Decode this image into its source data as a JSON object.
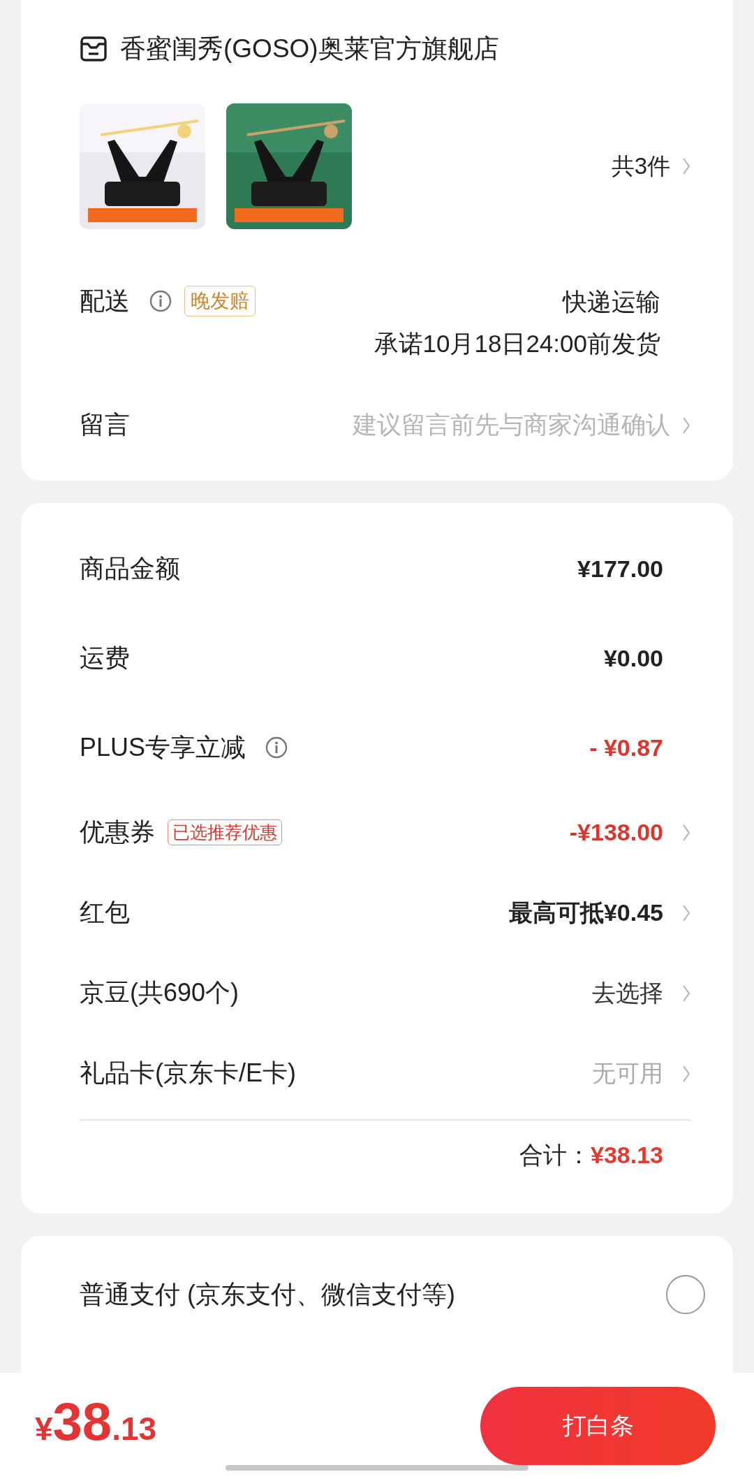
{
  "store": {
    "name": "香蜜闺秀(GOSO)奥莱官方旗舰店"
  },
  "item_count": "共3件",
  "delivery": {
    "label": "配送",
    "badge": "晚发赔",
    "method": "快递运输",
    "promise": "承诺10月18日24:00前发货"
  },
  "message": {
    "label": "留言",
    "hint": "建议留言前先与商家沟通确认"
  },
  "summary": [
    {
      "label": "商品金额",
      "info": false,
      "value": "¥177.00",
      "kind": "plain",
      "arrow": false
    },
    {
      "label": "运费",
      "info": false,
      "value": "¥0.00",
      "kind": "plain",
      "arrow": false
    },
    {
      "label": "PLUS专享立减",
      "info": true,
      "value": "- ¥0.87",
      "kind": "discount",
      "arrow": false
    },
    {
      "label": "优惠券",
      "info": false,
      "tag": "已选推荐优惠",
      "value": "-¥138.00",
      "kind": "discount",
      "arrow": true
    },
    {
      "label": "红包",
      "info": false,
      "value": "最高可抵¥0.45",
      "kind": "plain",
      "arrow": true
    },
    {
      "label": "京豆(共690个)",
      "info": false,
      "value": "去选择",
      "kind": "normal",
      "arrow": true
    },
    {
      "label": "礼品卡(京东卡/E卡)",
      "info": false,
      "value": "无可用",
      "kind": "muted",
      "arrow": true
    }
  ],
  "total": {
    "label": "合计：",
    "value": "¥38.13"
  },
  "payments": [
    {
      "label": "普通支付 (京东支付、微信支付等)",
      "selected": false
    }
  ],
  "footer": {
    "currency": "¥",
    "amount": "38",
    "decimals": ".13",
    "button": "打白条"
  }
}
